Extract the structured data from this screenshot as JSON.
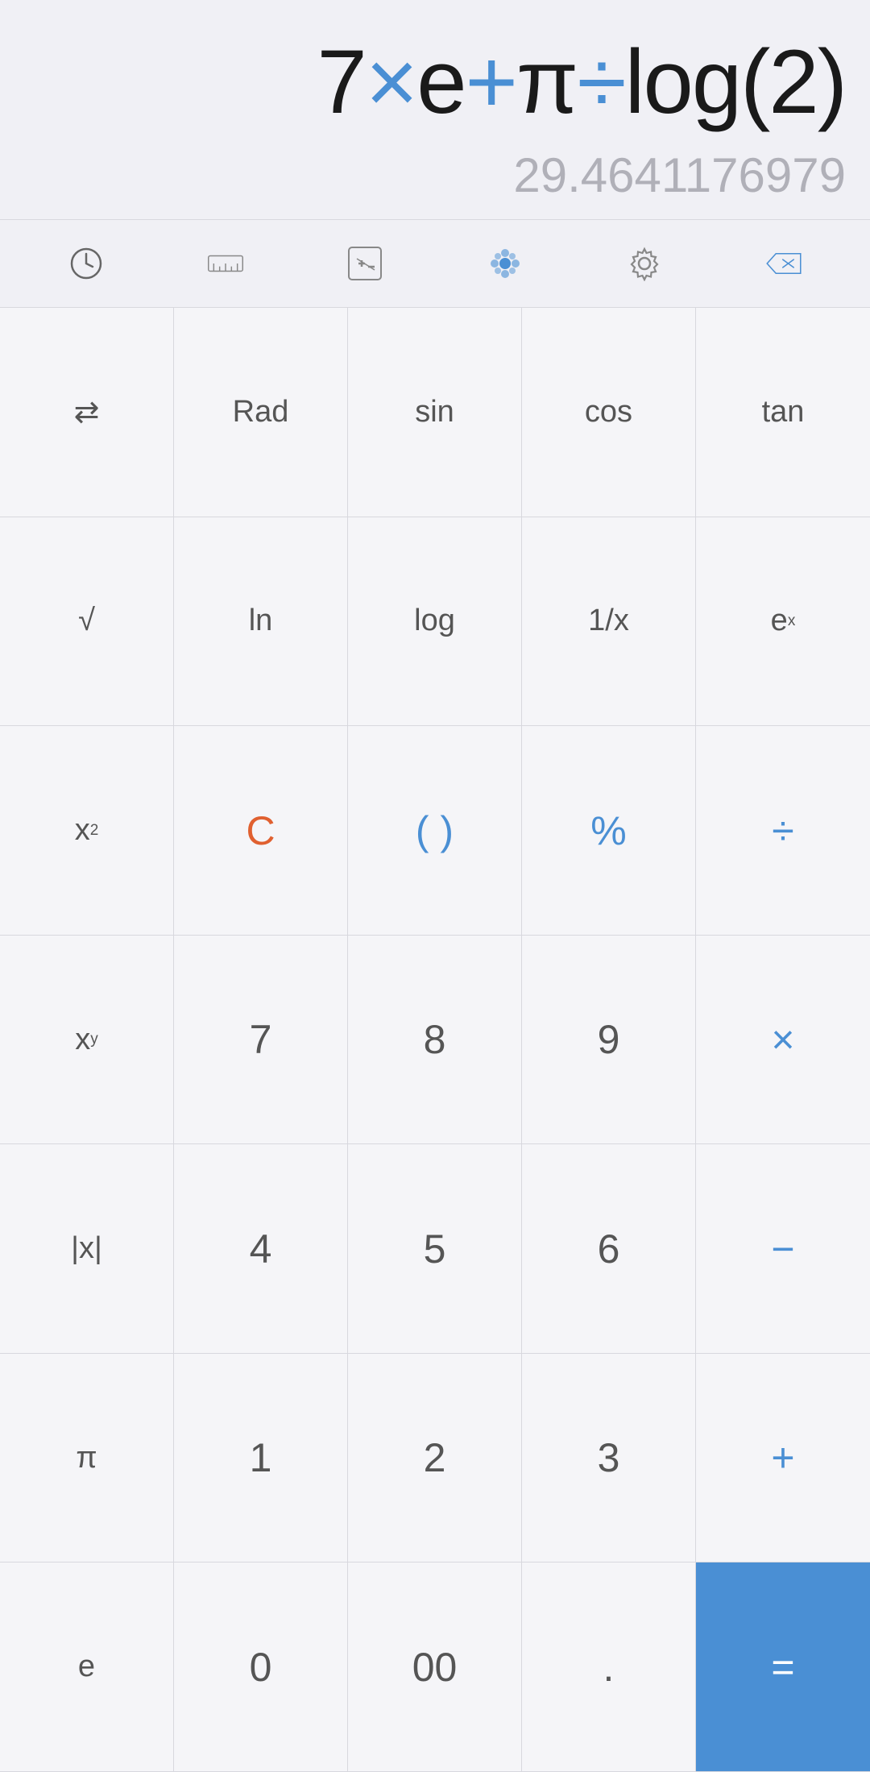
{
  "display": {
    "expression_parts": [
      {
        "text": "7",
        "class": "dark-char"
      },
      {
        "text": "×",
        "class": "blue-char"
      },
      {
        "text": "e",
        "class": "dark-char"
      },
      {
        "text": "+",
        "class": "blue-char"
      },
      {
        "text": "π",
        "class": "dark-char"
      },
      {
        "text": "÷",
        "class": "blue-char"
      },
      {
        "text": "log(2)",
        "class": "dark-char"
      }
    ],
    "result": "29.4641176979"
  },
  "toolbar": {
    "history_label": "History",
    "ruler_label": "Ruler",
    "plusminus_label": "PlusMinus",
    "theme_label": "Theme",
    "settings_label": "Settings",
    "backspace_label": "Backspace"
  },
  "buttons": [
    {
      "label": "⇄",
      "name": "swap-btn",
      "class": "small-text"
    },
    {
      "label": "Rad",
      "name": "rad-btn",
      "class": "small-text"
    },
    {
      "label": "sin",
      "name": "sin-btn",
      "class": "small-text"
    },
    {
      "label": "cos",
      "name": "cos-btn",
      "class": "small-text"
    },
    {
      "label": "tan",
      "name": "tan-btn",
      "class": "small-text"
    },
    {
      "label": "√",
      "name": "sqrt-btn",
      "class": "small-text"
    },
    {
      "label": "ln",
      "name": "ln-btn",
      "class": "small-text"
    },
    {
      "label": "log",
      "name": "log-btn",
      "class": "small-text"
    },
    {
      "label": "1/x",
      "name": "reciprocal-btn",
      "class": "small-text"
    },
    {
      "label": "eˣ",
      "name": "exp-btn",
      "class": "small-text"
    },
    {
      "label": "x²",
      "name": "square-btn",
      "class": "small-text"
    },
    {
      "label": "C",
      "name": "clear-btn",
      "class": "orange-c"
    },
    {
      "label": "( )",
      "name": "paren-btn",
      "class": "blue-op"
    },
    {
      "label": "%",
      "name": "percent-btn",
      "class": "blue-op"
    },
    {
      "label": "÷",
      "name": "divide-btn",
      "class": "blue-op"
    },
    {
      "label": "xʸ",
      "name": "power-btn",
      "class": "small-text"
    },
    {
      "label": "7",
      "name": "seven-btn",
      "class": ""
    },
    {
      "label": "8",
      "name": "eight-btn",
      "class": ""
    },
    {
      "label": "9",
      "name": "nine-btn",
      "class": ""
    },
    {
      "label": "×",
      "name": "multiply-btn",
      "class": "blue-op"
    },
    {
      "label": "|x|",
      "name": "abs-btn",
      "class": "small-text"
    },
    {
      "label": "4",
      "name": "four-btn",
      "class": ""
    },
    {
      "label": "5",
      "name": "five-btn",
      "class": ""
    },
    {
      "label": "6",
      "name": "six-btn",
      "class": ""
    },
    {
      "label": "−",
      "name": "minus-btn",
      "class": "blue-op"
    },
    {
      "label": "π",
      "name": "pi-btn",
      "class": "small-text"
    },
    {
      "label": "1",
      "name": "one-btn",
      "class": ""
    },
    {
      "label": "2",
      "name": "two-btn",
      "class": ""
    },
    {
      "label": "3",
      "name": "three-btn",
      "class": ""
    },
    {
      "label": "+",
      "name": "plus-btn",
      "class": "blue-op"
    },
    {
      "label": "e",
      "name": "euler-btn",
      "class": "small-text"
    },
    {
      "label": "0",
      "name": "zero-btn",
      "class": ""
    },
    {
      "label": "00",
      "name": "double-zero-btn",
      "class": ""
    },
    {
      "label": ".",
      "name": "decimal-btn",
      "class": ""
    },
    {
      "label": "=",
      "name": "equals-btn",
      "class": "equals-btn"
    }
  ]
}
